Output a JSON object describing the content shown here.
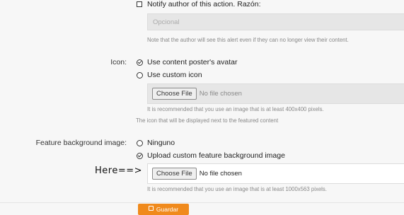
{
  "notify": {
    "label": "Notify author of this action. Razón:",
    "placeholder": "Opcional",
    "help": "Note that the author will see this alert even if they can no longer view their content."
  },
  "icon": {
    "label": "Icon:",
    "option_avatar": "Use content poster's avatar",
    "option_custom": "Use custom icon",
    "file_button": "Choose File",
    "file_status": "No file chosen",
    "file_help": "It is recommended that you use an image that is at least 400x400 pixels.",
    "field_help": "The icon that will be displayed next to the featured content"
  },
  "feature_bg": {
    "label": "Feature background image:",
    "option_none": "Ninguno",
    "option_upload": "Upload custom feature background image",
    "file_button": "Choose File",
    "file_status": "No file chosen",
    "file_help": "It is recommended that you use an image that is at least 1000x563 pixels."
  },
  "annotation": "Here==>",
  "footer": {
    "save_label": "Guardar"
  },
  "colors": {
    "accent": "#f08a1c",
    "disabled_bg": "#e6e6e6"
  }
}
